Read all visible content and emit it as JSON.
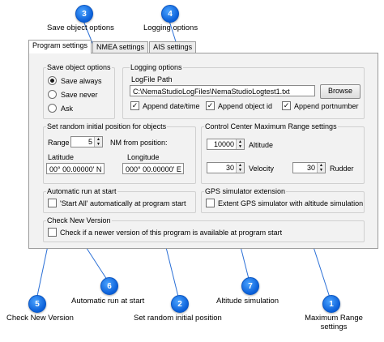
{
  "callouts": [
    {
      "num": "3",
      "label": "Save object options"
    },
    {
      "num": "4",
      "label": "Logging options"
    },
    {
      "num": "5",
      "label": "Check New Version"
    },
    {
      "num": "6",
      "label": "Automatic run at start"
    },
    {
      "num": "2",
      "label": "Set random initial position"
    },
    {
      "num": "7",
      "label": "Altitude simulation"
    },
    {
      "num": "1",
      "label": "Maximum Range settings"
    }
  ],
  "tabs": [
    "Program settings",
    "NMEA settings",
    "AIS settings"
  ],
  "save_object": {
    "title": "Save object options",
    "options": [
      "Save always",
      "Save never",
      "Ask"
    ],
    "selected": "Save always"
  },
  "logging": {
    "title": "Logging options",
    "logfile_label": "LogFile Path",
    "logfile_path": "C:\\NemaStudioLogFiles\\NemaStudioLogtest1.txt",
    "browse_label": "Browse",
    "append_date": "Append date/time",
    "append_object": "Append object id",
    "append_port": "Append portnumber"
  },
  "random_pos": {
    "title": "Set random initial position for objects",
    "range_label": "Range",
    "range_value": "5",
    "nm_label": "NM from position:",
    "lat_label": "Latitude",
    "lat_value": "00° 00.00000' N",
    "lon_label": "Longitude",
    "lon_value": "000° 00.00000' E"
  },
  "max_range": {
    "title": "Control Center Maximum Range settings",
    "altitude_value": "10000",
    "altitude_label": "Altitude",
    "velocity_value": "30",
    "velocity_label": "Velocity",
    "rudder_value": "30",
    "rudder_label": "Rudder"
  },
  "auto_run": {
    "title": "Automatic run at start",
    "check_label": "'Start All' automatically at program start"
  },
  "gps_ext": {
    "title": "GPS simulator extension",
    "check_label": "Extent GPS simulator with altitude simulation"
  },
  "new_version": {
    "title": "Check New Version",
    "check_label": "Check if a newer version of this program is available  at program start"
  }
}
